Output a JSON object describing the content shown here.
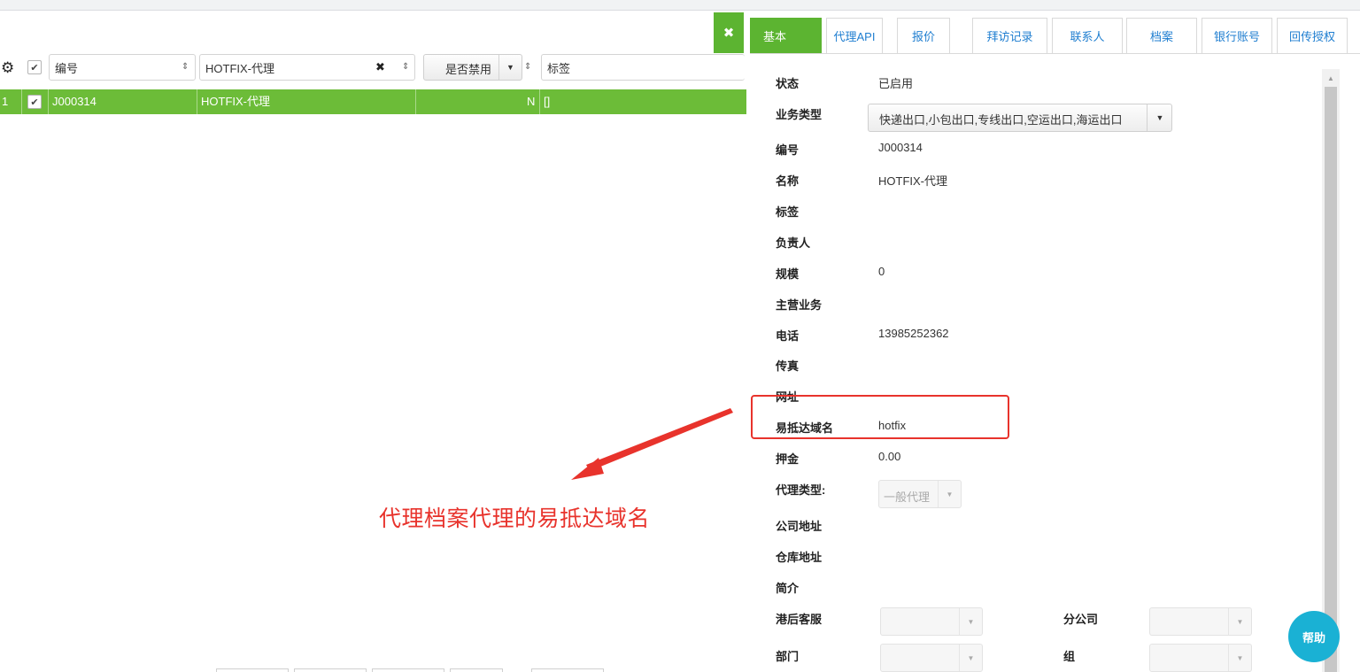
{
  "colors": {
    "accent": "#5cb431",
    "row_selected": "#6cbc38",
    "annotation": "#e8332c",
    "tab_link": "#1f7ed0",
    "help": "#1ab1d4"
  },
  "grid": {
    "close_icon": "close-icon",
    "header": {
      "settings_icon": "gear-icon",
      "col_code": "编号",
      "col_name_filter": "HOTFIX-代理",
      "col_disabled": "是否禁用",
      "col_tags": "标签"
    },
    "rows": [
      {
        "index": "1",
        "code": "J000314",
        "name": "HOTFIX-代理",
        "disabled": "N",
        "tags": "[]"
      }
    ]
  },
  "annotation": {
    "text": "代理档案代理的易抵达域名"
  },
  "tabs": [
    "基本",
    "代理API",
    "报价",
    "拜访记录",
    "联系人",
    "档案",
    "银行账号",
    "回传授权"
  ],
  "form": {
    "status_label": "状态",
    "status_value": "已启用",
    "business_type_label": "业务类型",
    "business_type_value": "快递出口,小包出口,专线出口,空运出口,海运出口",
    "code_label": "编号",
    "code_value": "J000314",
    "name_label": "名称",
    "name_value": "HOTFIX-代理",
    "tags_label": "标签",
    "owner_label": "负责人",
    "scale_label": "规模",
    "scale_value": "0",
    "main_business_label": "主营业务",
    "phone_label": "电话",
    "phone_value": "13985252362",
    "fax_label": "传真",
    "website_label": "网址",
    "domain_label": "易抵达域名",
    "domain_value": "hotfix",
    "deposit_label": "押金",
    "deposit_value": "0.00",
    "agent_type_label": "代理类型:",
    "agent_type_value": "一般代理",
    "company_address_label": "公司地址",
    "warehouse_address_label": "仓库地址",
    "intro_label": "简介",
    "port_cs_label": "港后客服",
    "branch_label": "分公司",
    "dept_label": "部门",
    "group_label": "组"
  },
  "help_label": "帮助"
}
